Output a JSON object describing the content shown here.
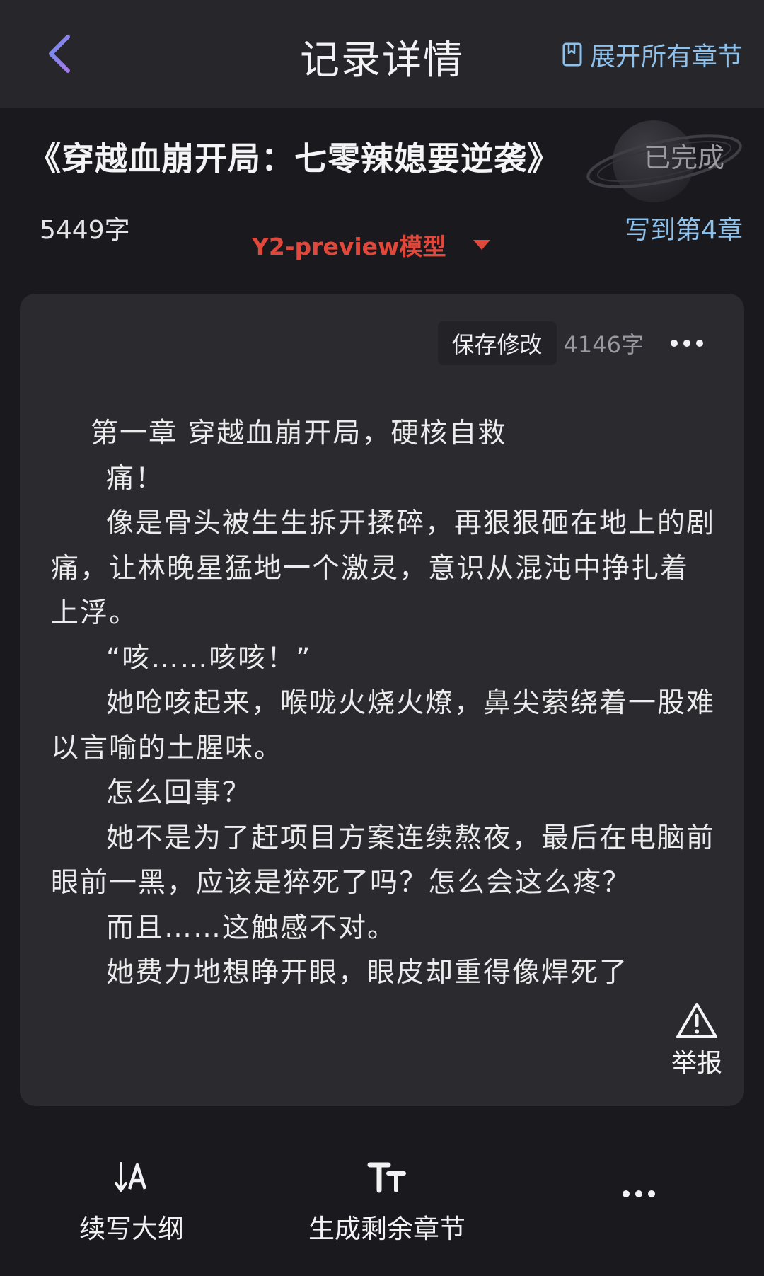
{
  "header": {
    "title": "记录详情",
    "expand_label": "展开所有章节"
  },
  "book": {
    "title": "《穿越血崩开局：七零辣媳要逆袭》",
    "status": "已完成",
    "word_total": "5449字",
    "model": "Y2-preview模型",
    "written_to": "写到第4章"
  },
  "editor": {
    "save_label": "保存修改",
    "chapter_word_count": "4146字",
    "paragraphs": [
      "第一章 穿越血崩开局，硬核自救",
      "痛！",
      "像是骨头被生生拆开揉碎，再狠狠砸在地上的剧痛，让林晚星猛地一个激灵，意识从混沌中挣扎着上浮。",
      "“咳……咳咳！”",
      "她呛咳起来，喉咙火烧火燎，鼻尖萦绕着一股难以言喻的土腥味。",
      "怎么回事？",
      "她不是为了赶项目方案连续熬夜，最后在电脑前眼前一黑，应该是猝死了吗？怎么会这么疼？",
      "而且……这触感不对。",
      "她费力地想睁开眼，眼皮却重得像焊死了"
    ],
    "report_label": "举报"
  },
  "bottom": {
    "outline_label": "续写大纲",
    "generate_label": "生成剩余章节"
  },
  "colors": {
    "accent_blue": "#8ec2ec",
    "model_red": "#e0483c",
    "back_purple": "#8f83ee",
    "background": "#1a1a1e",
    "card": "#2b2b2f"
  }
}
